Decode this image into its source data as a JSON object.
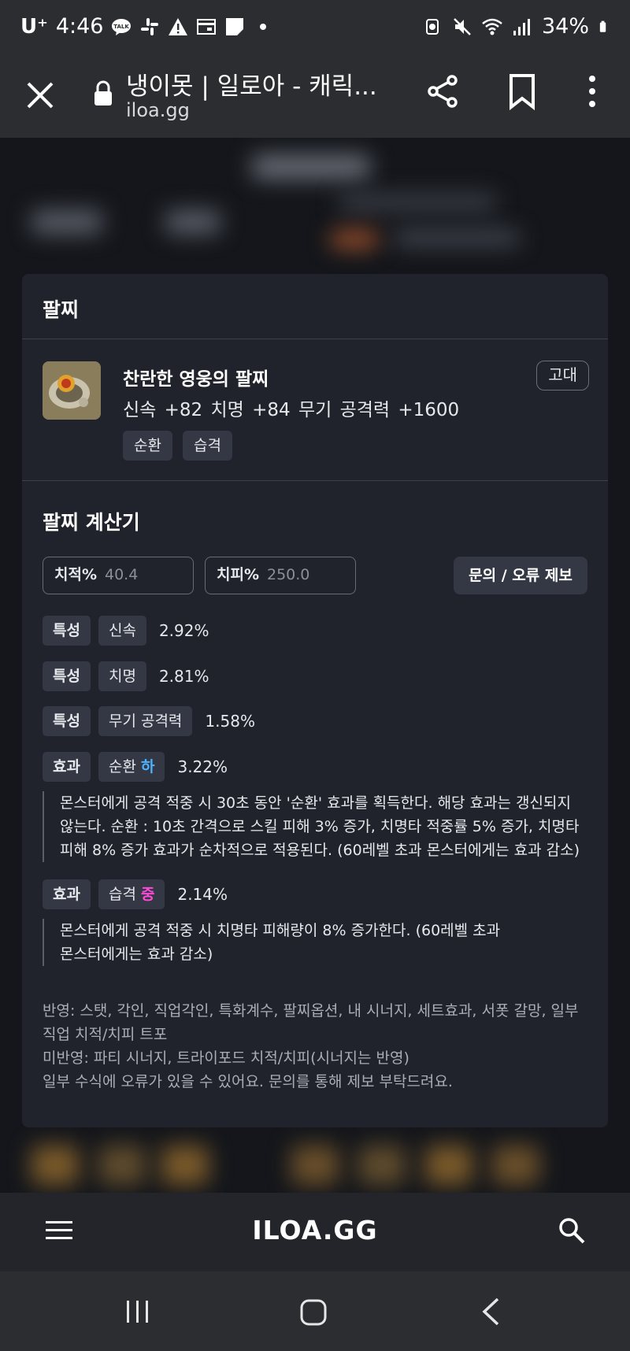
{
  "status_bar": {
    "carrier": "U⁺",
    "time": "4:46",
    "battery": "34%"
  },
  "browser": {
    "title": "냉이못 | 일로아 - 캐릭...",
    "url": "iloa.gg"
  },
  "modal": {
    "title": "팔찌",
    "item": {
      "name": "찬란한 영웅의 팔찌",
      "stats": "신속 +82  치명 +84  무기 공격력 +1600",
      "grade": "고대",
      "tags": [
        "순환",
        "습격"
      ]
    },
    "calculator": {
      "title": "팔찌 계산기",
      "crit_rate": {
        "label": "치적%",
        "value": "40.4"
      },
      "crit_damage": {
        "label": "치피%",
        "value": "250.0"
      },
      "report_label": "문의 / 오류 제보",
      "rows": [
        {
          "kind": "특성",
          "name": "신속",
          "percent": "2.92%"
        },
        {
          "kind": "특성",
          "name": "치명",
          "percent": "2.81%"
        },
        {
          "kind": "특성",
          "name": "무기 공격력",
          "percent": "1.58%"
        },
        {
          "kind": "효과",
          "name": "순환",
          "level": "하",
          "percent": "3.22%",
          "description": [
            "몬스터에게 공격 적중 시 30초 동안 '순환' 효과를 획득한다. 해당 효과는 갱신되지",
            "않는다. 순환 : 10초 간격으로 스킬 피해 3% 증가, 치명타 적중률 5% 증가, 치명타",
            "피해 8% 증가 효과가 순차적으로 적용된다. (60레벨 초과 몬스터에게는 효과 감소)"
          ]
        },
        {
          "kind": "효과",
          "name": "습격",
          "level": "중",
          "percent": "2.14%",
          "description": [
            "몬스터에게 공격 적중 시 치명타 피해량이 8% 증가한다. (60레벨 초과",
            "몬스터에게는 효과 감소)"
          ]
        }
      ],
      "notes": [
        "반영: 스탯, 각인, 직업각인, 특화계수, 팔찌옵션, 내 시너지, 세트효과, 서폿 갈망, 일부",
        "직업 치적/치피 트포",
        "미반영: 파티 시너지, 트라이포드 치적/치피(시너지는 반영)",
        "일부 수식에 오류가 있을 수 있어요. 문의를 통해 제보 부탁드려요."
      ]
    }
  },
  "site_nav": {
    "brand": "ILOA.GG"
  },
  "icons": {
    "close": "close-icon",
    "lock": "lock-icon",
    "share": "share-icon",
    "bookmark": "bookmark-icon",
    "more": "more-vertical-icon",
    "menu": "hamburger-menu-icon",
    "search": "search-icon",
    "recent": "recent-apps-icon",
    "home": "home-icon",
    "back": "back-icon"
  },
  "colors": {
    "level_low": "#4db3ff",
    "level_mid": "#ff48d8"
  }
}
